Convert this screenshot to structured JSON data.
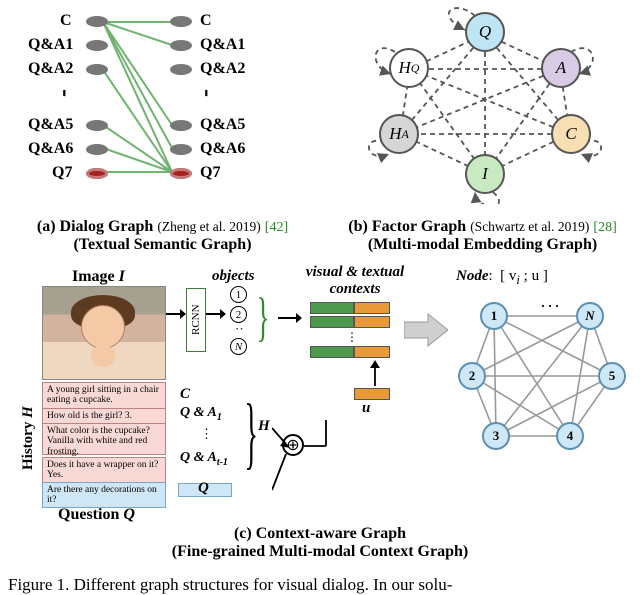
{
  "top": {
    "dialog": {
      "nodes": [
        "C",
        "Q&A1",
        "Q&A2",
        "Q&A5",
        "Q&A6",
        "Q7"
      ],
      "caption_bold": "(a) Dialog Graph",
      "caption_ref": "(Zheng et al. 2019)",
      "caption_cite": "[42]",
      "caption_sub": "(Textual Semantic Graph)"
    },
    "factor": {
      "nodes": {
        "Q": "Q",
        "A": "A",
        "C": "C",
        "I": "I",
        "HA": "H",
        "HA_sub": "A",
        "HQ": "H",
        "HQ_sub": "Q"
      },
      "caption_bold": "(b) Factor Graph",
      "caption_ref": "(Schwartz et al. 2019)",
      "caption_cite": "[28]",
      "caption_sub": "(Multi-modal Embedding Graph)"
    }
  },
  "bot": {
    "image_label": "Image",
    "I": "I",
    "hist_label": "History",
    "H": "H",
    "history": {
      "caption": "A young girl sitting in a chair eating a cupcake.",
      "qa1": "How old is the girl?  3.",
      "qa2": "What color is the cupcake? Vanilla with white and red frosting.",
      "qa3": "Does it have a wrapper on it?  Yes."
    },
    "question": "Are there any decorations on it?",
    "question_label": "Question",
    "Q": "Q",
    "rcnn": "RCNN",
    "objects_label": "objects",
    "vis_tex_label": "visual & textual\ncontexts",
    "u_label": "u",
    "C": "C",
    "QA1": "Q & A",
    "QA1_sub": "1",
    "QAt": "Q & A",
    "QAt_sub": "t-1",
    "H_sym": "H",
    "node_label": "Node",
    "node_expr": "[ v",
    "node_i": "i",
    "node_expr2": " ; u ]",
    "node_ids": [
      "1",
      "2",
      "3",
      "4",
      "5",
      "N"
    ],
    "caption_bold": "(c) Context-aware Graph",
    "caption_sub": "(Fine-grained Multi-modal Context Graph)"
  },
  "figure_caption": "Figure 1. Different graph structures for visual dialog. In our solu-"
}
